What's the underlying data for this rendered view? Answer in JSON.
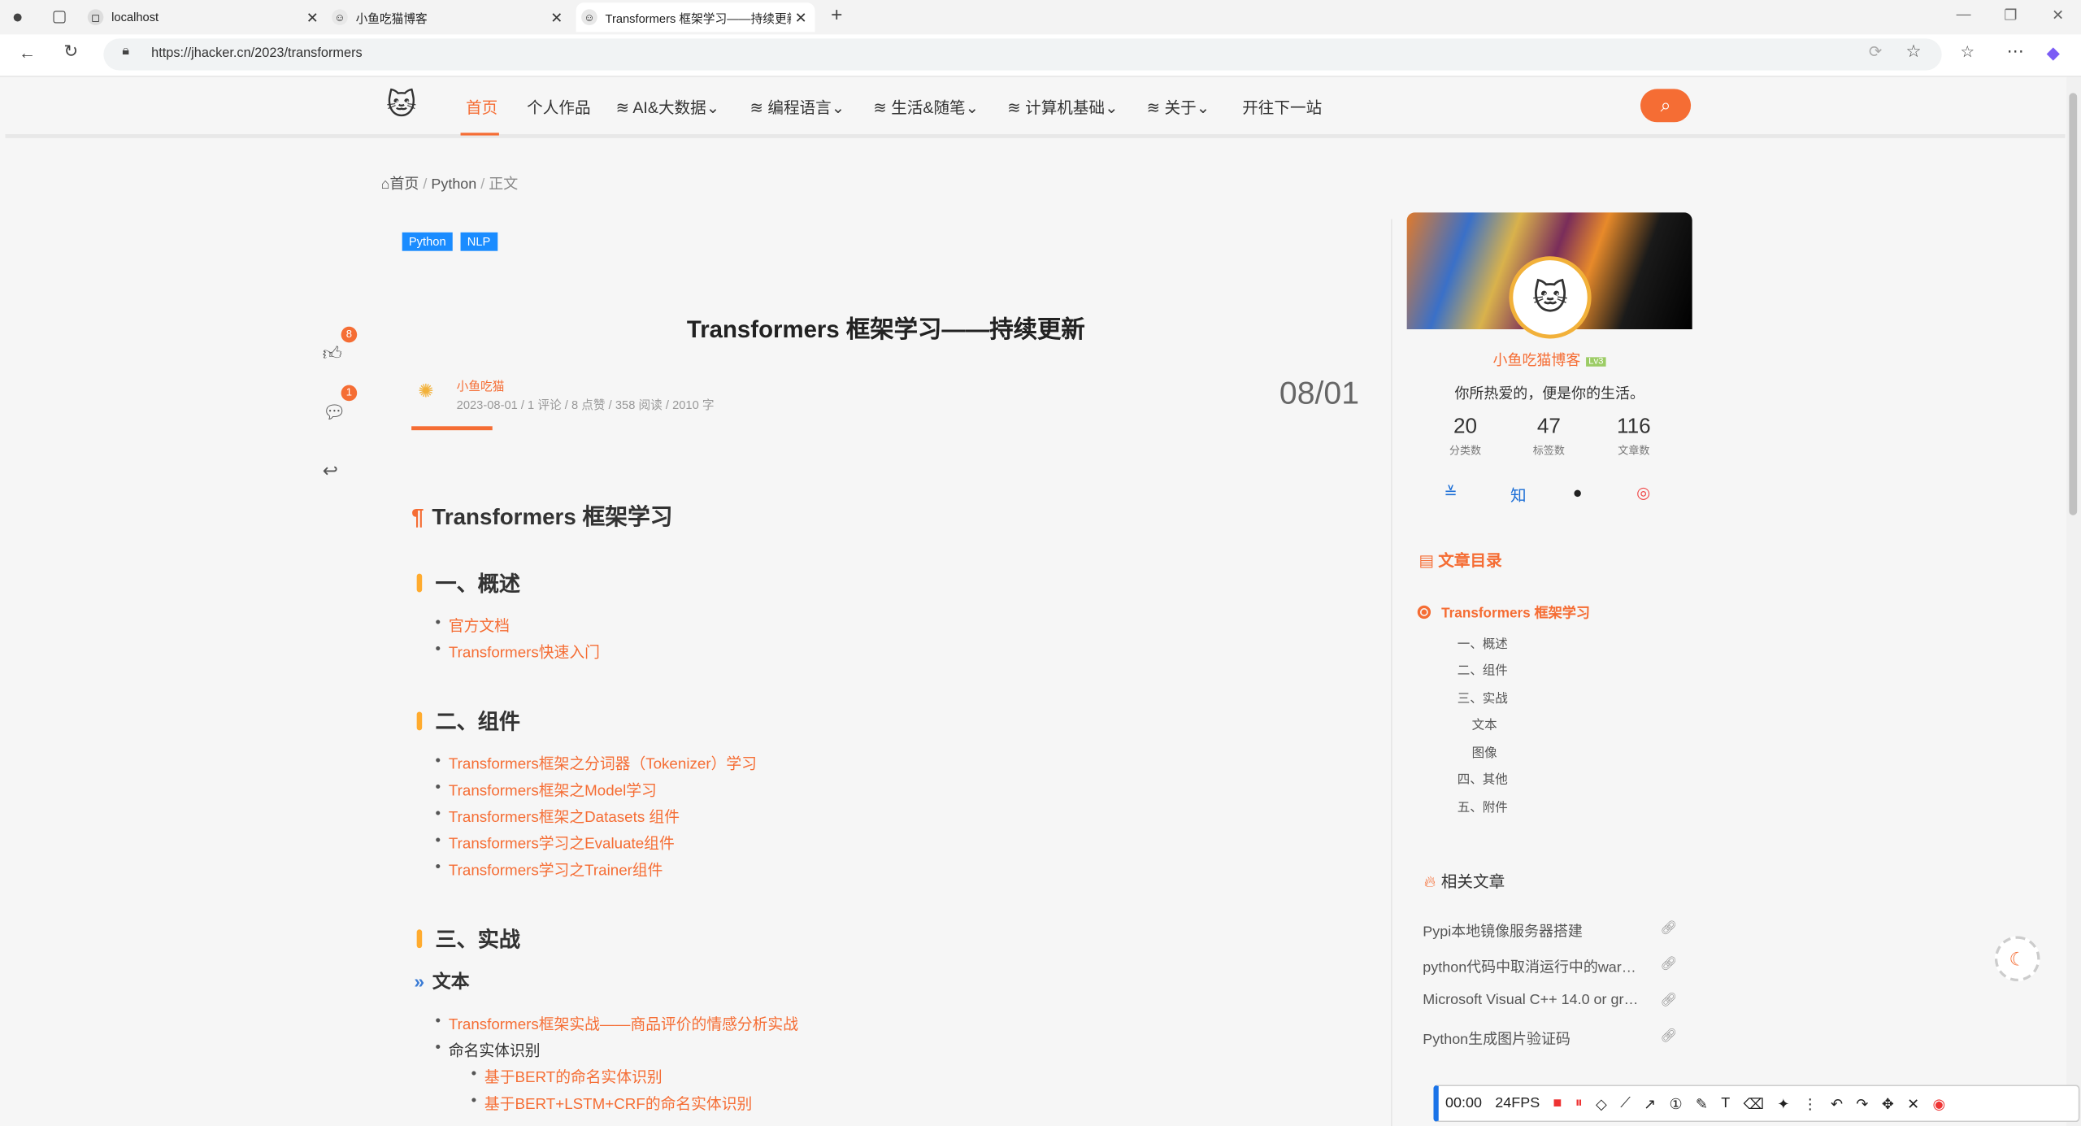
{
  "browser": {
    "tabs": [
      {
        "title": "localhost"
      },
      {
        "title": "小鱼吃猫博客"
      },
      {
        "title": "Transformers 框架学习——持续更新"
      }
    ],
    "new_tab": "+",
    "url": "https://jhacker.cn/2023/transformers"
  },
  "nav": {
    "items": [
      "首页",
      "个人作品",
      "AI&大数据",
      "编程语言",
      "生活&随笔",
      "计算机基础",
      "关于",
      "开往下一站"
    ],
    "active": "首页"
  },
  "breadcrumb": {
    "home": "首页",
    "cat": "Python",
    "current": "正文",
    "sep": "/"
  },
  "article": {
    "tags": [
      "Python",
      "NLP"
    ],
    "title": "Transformers 框架学习——持续更新",
    "author": "小鱼吃猫",
    "meta": "2023-08-01 / 1 评论 / 8 点赞 / 358 阅读 / 2010 字",
    "date_big": "08/01",
    "like_count": "8",
    "comment_count": "1",
    "h1": "Transformers 框架学习",
    "sections": [
      {
        "title": "一、概述",
        "items": [
          "官方文档",
          "Transformers快速入门"
        ]
      },
      {
        "title": "二、组件",
        "items": [
          "Transformers框架之分词器（Tokenizer）学习",
          "Transformers框架之Model学习",
          "Transformers框架之Datasets 组件",
          "Transformers学习之Evaluate组件",
          "Transformers学习之Trainer组件"
        ]
      },
      {
        "title": "三、实战",
        "sub": "文本",
        "items": [
          "Transformers框架实战——商品评价的情感分析实战",
          "命名实体识别"
        ],
        "subitems": [
          "基于BERT的命名实体识别",
          "基于BERT+LSTM+CRF的命名实体识别"
        ]
      }
    ]
  },
  "sidebar": {
    "name": "小鱼吃猫博客",
    "level": "Lv3",
    "motto": "你所热爱的，便是你的生活。",
    "stats": [
      {
        "n": "20",
        "l": "分类数"
      },
      {
        "n": "47",
        "l": "标签数"
      },
      {
        "n": "116",
        "l": "文章数"
      }
    ],
    "zhihu": "知",
    "toc_title": "文章目录",
    "toc_root": "Transformers 框架学习",
    "toc": [
      "一、概述",
      "二、组件",
      "三、实战",
      "文本",
      "图像",
      "四、其他",
      "五、附件"
    ],
    "related_title": "相关文章",
    "related": [
      "Pypi本地镜像服务器搭建",
      "python代码中取消运行中的warning...",
      "Microsoft Visual C++ 14.0 or greater...",
      "Python生成图片验证码"
    ]
  },
  "recorder": {
    "time": "00:00",
    "fps": "24FPS"
  }
}
